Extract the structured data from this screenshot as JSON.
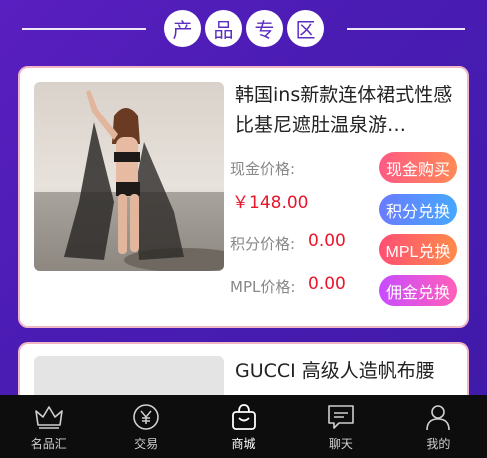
{
  "section": {
    "title_chars": [
      "产",
      "品",
      "专",
      "区"
    ]
  },
  "products": [
    {
      "title": "韩国ins新款连体裙式性感比基尼遮肚温泉游…",
      "cash_label": "现金价格:",
      "cash_value": "￥148.00",
      "points_label": "积分价格:",
      "points_value": "0.00",
      "mpl_label": "MPL价格:",
      "mpl_value": "0.00",
      "buttons": {
        "buy": "现金购买",
        "points": "积分兑换",
        "mpl": "MPL兑换",
        "commission": "佣金兑换"
      }
    },
    {
      "title": "GUCCI 高级人造帆布腰"
    }
  ],
  "tabbar": {
    "items": [
      {
        "label": "名品汇",
        "icon": "crown-icon"
      },
      {
        "label": "交易",
        "icon": "yen-coin-icon"
      },
      {
        "label": "商城",
        "icon": "shopping-bag-icon"
      },
      {
        "label": "聊天",
        "icon": "chat-icon"
      },
      {
        "label": "我的",
        "icon": "user-icon"
      }
    ],
    "active": "商城"
  },
  "colors": {
    "background": "#4a1cb4",
    "price_red": "#e8152b",
    "accent_purple": "#5b2ec2"
  }
}
